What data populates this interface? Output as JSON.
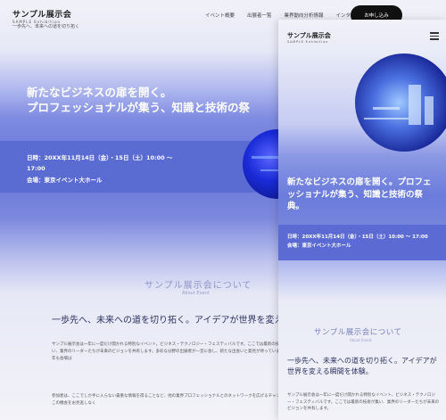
{
  "desktop": {
    "logo": {
      "title": "サンプル展示会",
      "subtitle": "SAMPLE Exhibition"
    },
    "tagline": "一歩先へ、未来への道を切り拓く",
    "nav": [
      "イベント概要",
      "出展者一覧",
      "業界動向分析情報",
      "インタビュー"
    ],
    "cta": "お申し込み",
    "hero": {
      "title_line1": "新たなビジネスの扉を開く。",
      "title_line2": "プロフェッショナルが集う、知識と技術の祭",
      "date": "日時：20XX年11月14日（金）・15日（土）10:00 〜",
      "date_cont": "17:00",
      "venue": "会場：東京イベント大ホール"
    },
    "about": {
      "title": "サンプル展示会について",
      "subtitle": "About Event",
      "lead": "一歩先へ、未来への道を切り拓く。アイデアが世界を変え",
      "body": "サンプル展示会は一年に一度だけ開かれる特別なイベント。ビジネス・テクノロジー・フェスティバルです。ここでは最新の技術が集い、業界のリーダーたちが未来のビジョンを共有します。多彩な分野の出展者が一堂に会し、新たな出会いと発見が待っています。今年も会場は",
      "body2": "参加者は、ここでしか手に入らない貴重な情報を得ることなど、他の業界プロフェッショナルとのネットワークを広げるチャンスも。この機会をお見逃しなく"
    }
  },
  "mobile": {
    "logo": {
      "title": "サンプル展示会",
      "subtitle": "SAMPLE Exhibition"
    },
    "hero": {
      "title": "新たなビジネスの扉を開く。プロフェッショナルが集う、知識と技術の祭典。",
      "date": "日時：20XX年11月14日（金）・15日（土）10:00 〜 17:00",
      "venue": "会場：東京イベント大ホール"
    },
    "about": {
      "title": "サンプル展示会について",
      "subtitle": "About Event",
      "lead": "一歩先へ、未来への道を切り拓く。アイデアが世界を変える瞬間を体験。",
      "body": "サンプル展示会は一年に一度だけ開かれる特別なイベント、ビジネス・テクノロジー・フェスティバルです。ここでは最新の技術が集い、業界のリーダーたちが未来のビジョンを共有します。"
    }
  },
  "colors": {
    "accent": "#5a6bd2",
    "cta_bg": "#111111",
    "heading_muted": "#9096c4"
  }
}
